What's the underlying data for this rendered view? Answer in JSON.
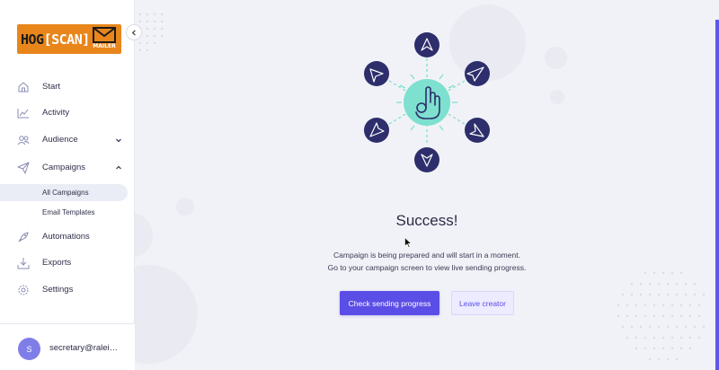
{
  "brand": {
    "logo_part1": "HOG",
    "logo_part2": "[SCAN]",
    "logo_sub": "MAILER",
    "accent": "#5b4ee6",
    "logo_bg": "#e8861c"
  },
  "sidebar": {
    "items": [
      {
        "label": "Start",
        "icon": "home-icon"
      },
      {
        "label": "Activity",
        "icon": "chart-line-icon"
      },
      {
        "label": "Audience",
        "icon": "users-icon",
        "chevron": "down"
      },
      {
        "label": "Campaigns",
        "icon": "paper-plane-icon",
        "chevron": "up"
      },
      {
        "label": "Automations",
        "icon": "rocket-icon"
      },
      {
        "label": "Exports",
        "icon": "download-icon"
      },
      {
        "label": "Settings",
        "icon": "gear-icon"
      }
    ],
    "subitems": [
      {
        "label": "All Campaigns",
        "active": true
      },
      {
        "label": "Email Templates",
        "active": false
      }
    ],
    "user": {
      "initial": "S",
      "email": "secretary@ralei…"
    }
  },
  "main": {
    "title": "Success!",
    "line1": "Campaign is being prepared and will start in a moment.",
    "line2": "Go to your campaign screen to view live sending progress.",
    "primary_button": "Check sending progress",
    "secondary_button": "Leave creator"
  }
}
